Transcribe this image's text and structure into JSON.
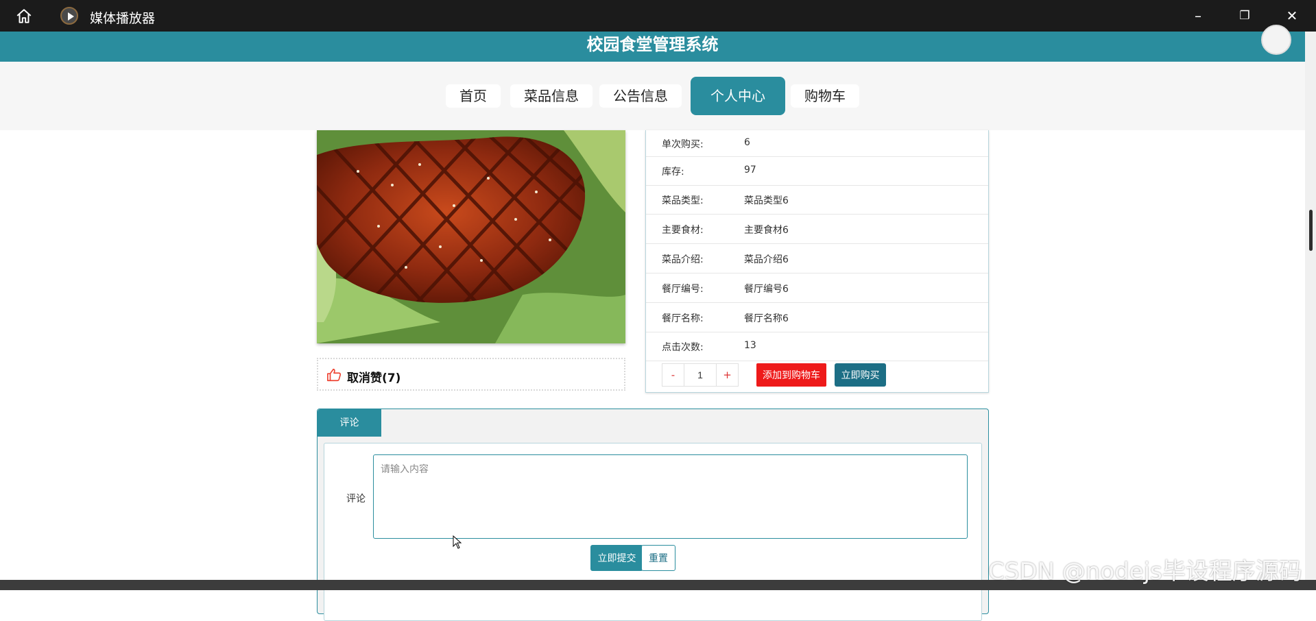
{
  "window": {
    "title": "媒体播放器",
    "home_icon": "home-icon",
    "app_icon": "media-player-icon"
  },
  "site": {
    "title": "校园食堂管理系统"
  },
  "nav": {
    "items": [
      {
        "label": "首页",
        "active": false
      },
      {
        "label": "菜品信息",
        "active": false
      },
      {
        "label": "公告信息",
        "active": false
      },
      {
        "label": "个人中心",
        "active": true
      },
      {
        "label": "购物车",
        "active": false
      }
    ]
  },
  "product": {
    "image_icon": "grilled-meat-dish-image",
    "like_label": "取消赞(7)",
    "details": [
      {
        "label": "单次购买:",
        "value": "6"
      },
      {
        "label": "库存:",
        "value": "97"
      },
      {
        "label": "菜品类型:",
        "value": "菜品类型6"
      },
      {
        "label": "主要食材:",
        "value": "主要食材6"
      },
      {
        "label": "菜品介绍:",
        "value": "菜品介绍6"
      },
      {
        "label": "餐厅编号:",
        "value": "餐厅编号6"
      },
      {
        "label": "餐厅名称:",
        "value": "餐厅名称6"
      },
      {
        "label": "点击次数:",
        "value": "13"
      }
    ],
    "quantity": {
      "minus": "-",
      "value": "1",
      "plus": "+"
    },
    "add_to_cart_label": "添加到购物车",
    "buy_now_label": "立即购买"
  },
  "comment": {
    "tab_label": "评论",
    "field_label": "评论",
    "placeholder": "请输入内容",
    "submit_label": "立即提交",
    "reset_label": "重置"
  },
  "watermark": "CSDN @nodejs毕设程序源码",
  "colors": {
    "primary": "#2a8d9e",
    "danger": "#ee1a1a",
    "buy": "#1c6e85",
    "titlebar": "#1b1b1b"
  }
}
